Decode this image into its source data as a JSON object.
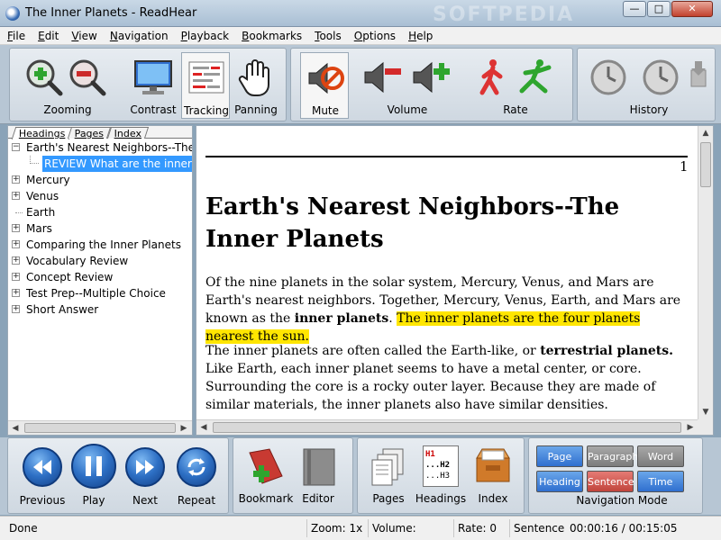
{
  "window": {
    "title": "The Inner Planets - ReadHear",
    "watermark": "SOFTPEDIA",
    "min_glyph": "—",
    "max_glyph": "□",
    "close_glyph": "✕"
  },
  "menu": [
    {
      "label": "File",
      "underline": "F",
      "rest": "ile"
    },
    {
      "label": "Edit",
      "underline": "E",
      "rest": "dit"
    },
    {
      "label": "View",
      "underline": "V",
      "rest": "iew"
    },
    {
      "label": "Navigation",
      "underline": "N",
      "rest": "avigation"
    },
    {
      "label": "Playback",
      "underline": "P",
      "rest": "layback"
    },
    {
      "label": "Bookmarks",
      "underline": "B",
      "rest": "ookmarks"
    },
    {
      "label": "Tools",
      "underline": "T",
      "rest": "ools"
    },
    {
      "label": "Options",
      "underline": "O",
      "rest": "ptions"
    },
    {
      "label": "Help",
      "underline": "H",
      "rest": "elp"
    }
  ],
  "toolbar": {
    "zooming": "Zooming",
    "contrast": "Contrast",
    "tracking": "Tracking",
    "panning": "Panning",
    "mute": "Mute",
    "volume": "Volume",
    "rate": "Rate",
    "history": "History"
  },
  "leftpanel": {
    "tabs": [
      "Headings",
      "Pages",
      "Index"
    ],
    "tree": [
      {
        "label": "Earth's Nearest Neighbors--The Inner Planets",
        "expander": "−"
      },
      {
        "label": "REVIEW What are the inner planets?",
        "selected": true
      },
      {
        "label": "Mercury",
        "expander": "+"
      },
      {
        "label": "Venus",
        "expander": "+"
      },
      {
        "label": "Earth"
      },
      {
        "label": "Mars",
        "expander": "+"
      },
      {
        "label": "Comparing the Inner Planets",
        "expander": "+"
      },
      {
        "label": "Vocabulary Review",
        "expander": "+"
      },
      {
        "label": "Concept Review",
        "expander": "+"
      },
      {
        "label": "Test Prep--Multiple Choice",
        "expander": "+"
      },
      {
        "label": "Short Answer",
        "expander": "+"
      }
    ]
  },
  "document": {
    "page_number": "1",
    "heading": "Earth's Nearest Neighbors--The Inner Planets",
    "p1_a": "Of the nine planets in the solar system, Mercury, Venus, and Mars are Earth's nearest neighbors. Together, Mercury, Venus, Earth, and Mars are known as the ",
    "p1_bold": "inner planets",
    "p1_b": ".",
    "p1_highlight": "The inner planets are the four planets nearest the sun.",
    "p2_a": "The inner planets are often called the Earth-like, or ",
    "p2_bold": "terrestrial planets.",
    "p2_b": " Like Earth, each inner planet seems to have a metal center, or core. Surrounding the core is a rocky outer layer. Because they are made of similar materials, the inner planets also have similar densities."
  },
  "controls": {
    "previous": "Previous",
    "play": "Play",
    "next": "Next",
    "repeat": "Repeat",
    "bookmark": "Bookmark",
    "editor": "Editor",
    "pages": "Pages",
    "headings": "Headings",
    "index": "Index",
    "navigation_mode": "Navigation Mode",
    "nav_buttons": {
      "page": "Page",
      "paragraph": "Paragraph",
      "word": "Word",
      "heading": "Heading",
      "sentence": "Sentence",
      "time": "Time"
    },
    "headings_icon_text": [
      "H1",
      "...H2",
      "...H3"
    ]
  },
  "status": {
    "state": "Done",
    "zoom": "Zoom: 1x",
    "volume": "Volume: Muted",
    "rate": "Rate: 0",
    "mode": "Sentence",
    "time": "00:00:16 / 00:15:05"
  }
}
